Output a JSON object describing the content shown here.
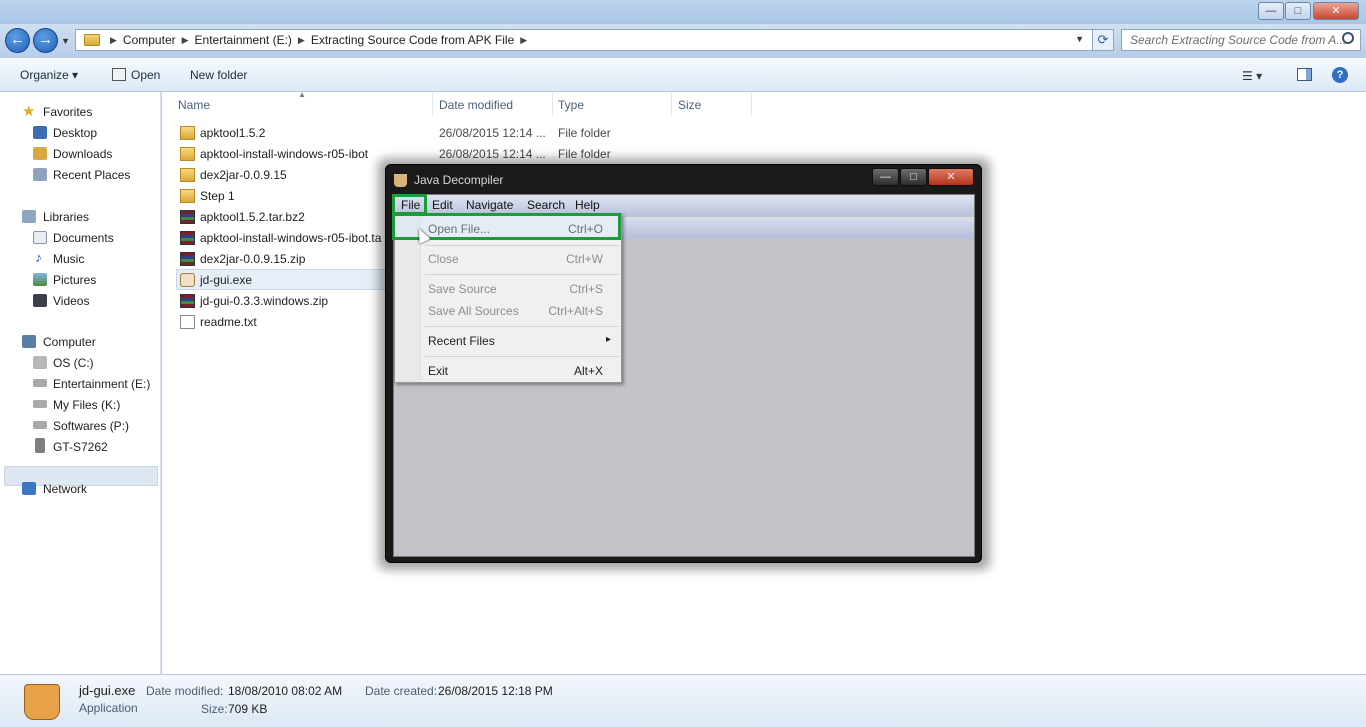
{
  "window": {
    "controls": {
      "minimize": "—",
      "maximize": "□",
      "close": "✕"
    }
  },
  "address": {
    "back": "←",
    "forward": "→",
    "crumbs": [
      "Computer",
      "Entertainment (E:)",
      "Extracting Source Code from APK File"
    ],
    "search_placeholder": "Search Extracting Source Code from A..."
  },
  "toolbar": {
    "organize": "Organize",
    "open": "Open",
    "new_folder": "New folder"
  },
  "nav": {
    "favorites": "Favorites",
    "fav_items": [
      "Desktop",
      "Downloads",
      "Recent Places"
    ],
    "libraries": "Libraries",
    "lib_items": [
      "Documents",
      "Music",
      "Pictures",
      "Videos"
    ],
    "computer": "Computer",
    "drives": [
      "OS (C:)",
      "Entertainment (E:)",
      "My Files (K:)",
      "Softwares (P:)",
      "GT-S7262"
    ],
    "network": "Network"
  },
  "columns": {
    "name": "Name",
    "date": "Date modified",
    "type": "Type",
    "size": "Size"
  },
  "files": [
    {
      "name": "apktool1.5.2",
      "date": "26/08/2015 12:14 ...",
      "type": "File folder",
      "icon": "folder-icon"
    },
    {
      "name": "apktool-install-windows-r05-ibot",
      "date": "26/08/2015 12:14 ...",
      "type": "File folder",
      "icon": "folder-icon"
    },
    {
      "name": "dex2jar-0.0.9.15",
      "date": "",
      "type": "",
      "icon": "folder-icon"
    },
    {
      "name": "Step 1",
      "date": "",
      "type": "",
      "icon": "folder-icon"
    },
    {
      "name": "apktool1.5.2.tar.bz2",
      "date": "",
      "type": "",
      "icon": "archive-icon"
    },
    {
      "name": "apktool-install-windows-r05-ibot.ta",
      "date": "",
      "type": "",
      "icon": "archive-icon"
    },
    {
      "name": "dex2jar-0.0.9.15.zip",
      "date": "",
      "type": "",
      "icon": "archive-icon"
    },
    {
      "name": "jd-gui.exe",
      "date": "",
      "type": "",
      "icon": "exe-icon"
    },
    {
      "name": "jd-gui-0.3.3.windows.zip",
      "date": "",
      "type": "",
      "icon": "archive-icon"
    },
    {
      "name": "readme.txt",
      "date": "",
      "type": "",
      "icon": "text-file-icon"
    }
  ],
  "jd": {
    "title": "Java Decompiler",
    "menus": [
      "File",
      "Edit",
      "Navigate",
      "Search",
      "Help"
    ],
    "file_menu": [
      {
        "label": "Open File...",
        "shortcut": "Ctrl+O",
        "enabled": true
      },
      {
        "label": "Close",
        "shortcut": "Ctrl+W",
        "enabled": false
      },
      {
        "label": "Save Source",
        "shortcut": "Ctrl+S",
        "enabled": false
      },
      {
        "label": "Save All Sources",
        "shortcut": "Ctrl+Alt+S",
        "enabled": false
      },
      {
        "label": "Recent Files",
        "shortcut": "▸",
        "enabled": true
      },
      {
        "label": "Exit",
        "shortcut": "Alt+X",
        "enabled": true
      }
    ],
    "highlight_color": "#1b9e3a"
  },
  "details": {
    "filename": "jd-gui.exe",
    "kind": "Application",
    "date_modified_label": "Date modified:",
    "date_modified": "18/08/2010 08:02 AM",
    "date_created_label": "Date created:",
    "date_created": "26/08/2015 12:18 PM",
    "size_label": "Size:",
    "size": "709 KB"
  }
}
